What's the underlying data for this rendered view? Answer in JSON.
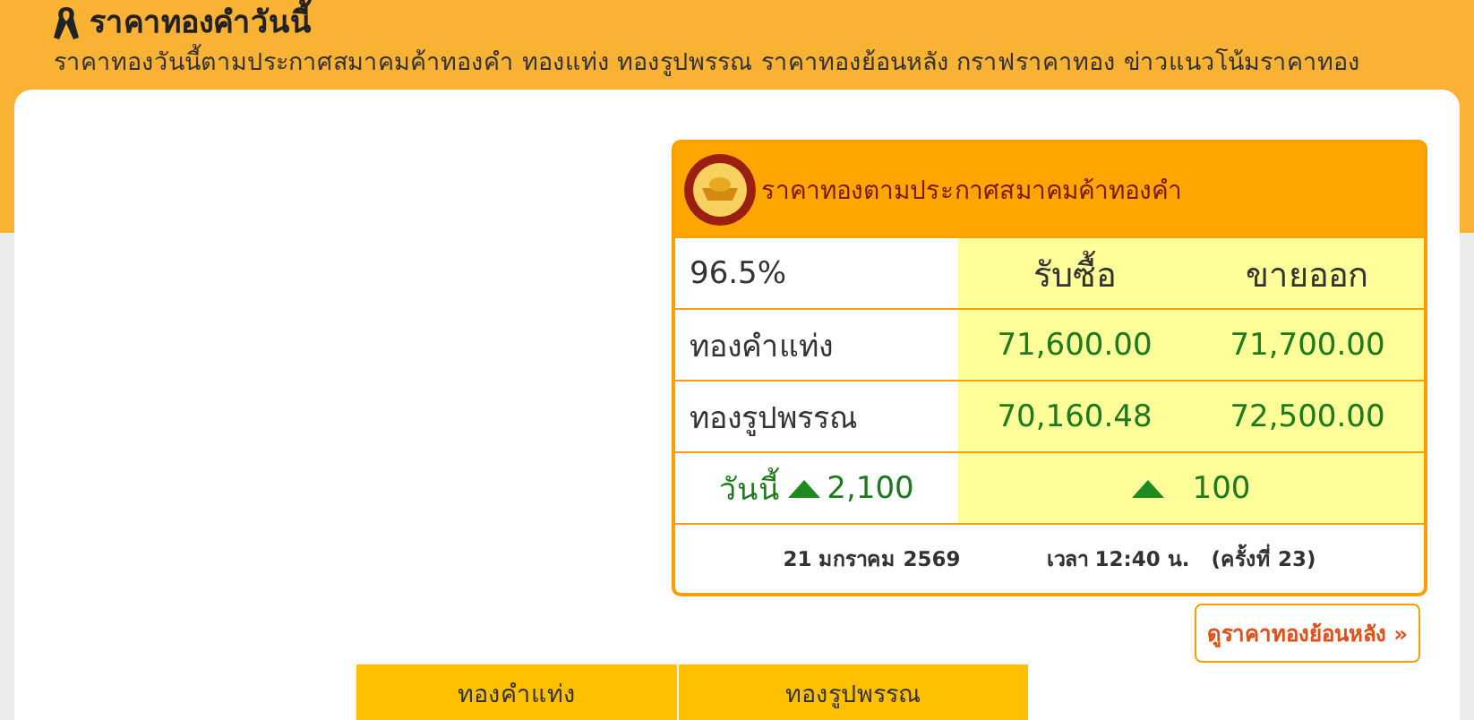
{
  "header": {
    "title": "ราคาทองคำวันนี้",
    "subtitle": "ราคาทองวันนี้ตามประกาศสมาคมค้าทองคำ ทองแท่ง ทองรูปพรรณ ราคาทองย้อนหลัง กราฟราคาทอง ข่าวแนวโน้มราคาทอง"
  },
  "price_box": {
    "title": "ราคาทองตามประกาศสมาคมค้าทองคำ",
    "columns": [
      "96.5%",
      "รับซื้อ",
      "ขายออก"
    ],
    "rows": [
      {
        "label": "ทองคำแท่ง",
        "buy": "71,600.00",
        "sell": "71,700.00"
      },
      {
        "label": "ทองรูปพรรณ",
        "buy": "70,160.48",
        "sell": "72,500.00"
      }
    ],
    "change": {
      "label": "วันนี้",
      "rising": true,
      "today": "2,100",
      "diff_rising": true,
      "diff": "100"
    },
    "footer": {
      "date": "21 มกราคม 2569",
      "time": "เวลา 12:40 น.",
      "round": "(ครั้งที่ 23)"
    }
  },
  "history_link": "ดูราคาทองย้อนหลัง »",
  "table": {
    "columns": [
      "ทองคำแท่ง",
      "ทองรูปพรรณ"
    ]
  }
}
